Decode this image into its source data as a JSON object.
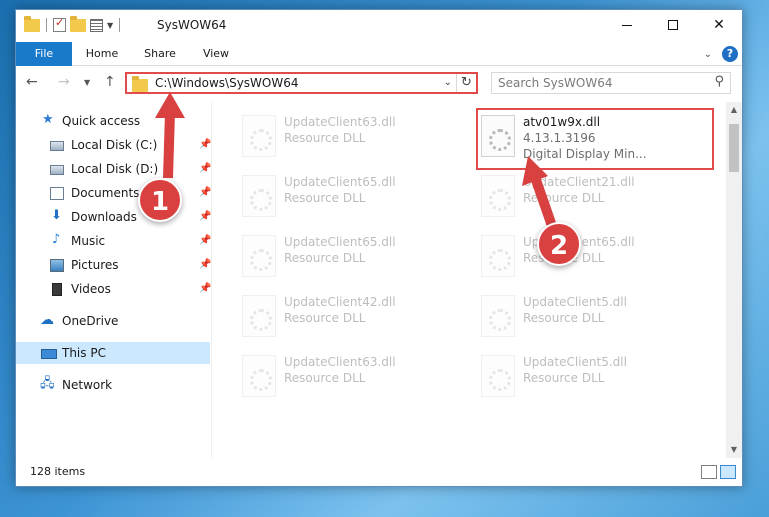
{
  "window": {
    "title": "SysWOW64"
  },
  "ribbon": {
    "tabs": [
      "File",
      "Home",
      "Share",
      "View"
    ],
    "help_label": "?"
  },
  "navbar": {
    "address": "C:\\Windows\\SysWOW64",
    "search_placeholder": "Search SysWOW64"
  },
  "sidebar": {
    "items": [
      {
        "label": "Quick access",
        "icon": "star-icon",
        "pinned": false
      },
      {
        "label": "Local Disk (C:)",
        "icon": "drive-icon",
        "pinned": true
      },
      {
        "label": "Local Disk (D:)",
        "icon": "drive-icon",
        "pinned": true
      },
      {
        "label": "Documents",
        "icon": "documents-icon",
        "pinned": true
      },
      {
        "label": "Downloads",
        "icon": "download-icon",
        "pinned": true
      },
      {
        "label": "Music",
        "icon": "music-icon",
        "pinned": true
      },
      {
        "label": "Pictures",
        "icon": "pictures-icon",
        "pinned": true
      },
      {
        "label": "Videos",
        "icon": "videos-icon",
        "pinned": true
      },
      {
        "label": "OneDrive",
        "icon": "cloud-icon",
        "pinned": false
      },
      {
        "label": "This PC",
        "icon": "computer-icon",
        "pinned": false,
        "selected": true
      },
      {
        "label": "Network",
        "icon": "network-icon",
        "pinned": false
      }
    ]
  },
  "files": {
    "left_column": [
      {
        "name": "UpdateClient63.dll",
        "type": "Resource DLL"
      },
      {
        "name": "UpdateClient65.dll",
        "type": "Resource DLL"
      },
      {
        "name": "UpdateClient65.dll",
        "type": "Resource DLL"
      },
      {
        "name": "UpdateClient42.dll",
        "type": "Resource DLL"
      },
      {
        "name": "UpdateClient63.dll",
        "type": "Resource DLL"
      }
    ],
    "right_column": [
      {
        "name": "atv01w9x.dll",
        "version": "4.13.1.3196",
        "description": "Digital Display Min...",
        "highlighted": true
      },
      {
        "name": "UpdateClient21.dll",
        "type": "Resource DLL"
      },
      {
        "name": "UpdateClient65.dll",
        "type": "Resource DLL"
      },
      {
        "name": "UpdateClient5.dll",
        "type": "Resource DLL"
      },
      {
        "name": "UpdateClient5.dll",
        "type": "Resource DLL"
      }
    ]
  },
  "status": {
    "count": "128 items"
  },
  "callouts": {
    "one": "1",
    "two": "2"
  },
  "colors": {
    "accent": "#1979ca",
    "highlight_red": "#e24b4b",
    "callout_red": "#d94040",
    "selection": "#cce8ff"
  }
}
